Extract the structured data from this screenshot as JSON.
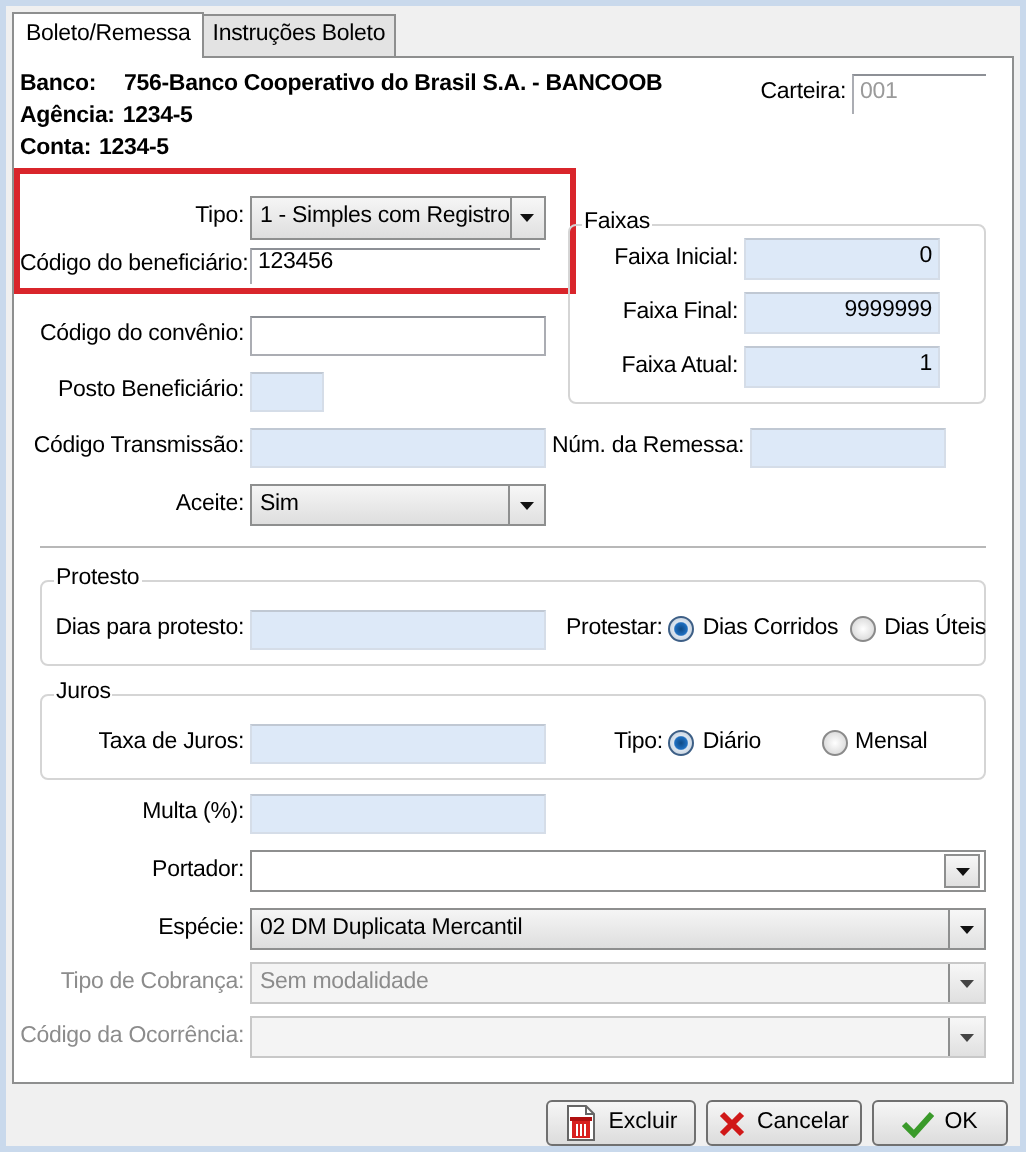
{
  "tabs": [
    {
      "label": "Boleto/Remessa",
      "selected": true
    },
    {
      "label": "Instruções Boleto",
      "selected": false
    }
  ],
  "bank_info": [
    {
      "label": "Banco:",
      "value": "756-Banco Cooperativo do Brasil S.A. - BANCOOB"
    },
    {
      "label": "Agência:",
      "value": "1234-5"
    },
    {
      "label": "Conta:",
      "value": "1234-5"
    }
  ],
  "carteira": {
    "label": "Carteira:",
    "value": "001",
    "disabled": true
  },
  "highlighted_fields": [
    {
      "kind": "dropdown",
      "label": "Tipo:",
      "value": "1 - Simples com Registro"
    },
    {
      "kind": "text",
      "label": "Código do beneficiário:",
      "value": "123456",
      "numeric": false
    }
  ],
  "convenio": {
    "label": "Código do convênio:",
    "numeric": false
  },
  "posto": {
    "label": "Posto Beneficiário:",
    "numeric": true
  },
  "faixas": {
    "title": "Faixas",
    "fields": [
      {
        "label": "Faixa Inicial:",
        "value": "0",
        "numeric": true
      },
      {
        "label": "Faixa Final:",
        "value": "9999999",
        "numeric": true
      },
      {
        "label": "Faixa Atual:",
        "value": "1",
        "numeric": true
      }
    ]
  },
  "transmissao": {
    "label": "Código Transmissão:",
    "numeric": true
  },
  "remessa": {
    "label": "Núm. da Remessa:",
    "numeric": true
  },
  "aceite": {
    "label": "Aceite:",
    "value": "Sim"
  },
  "protesto": {
    "title": "Protesto",
    "field_label": "Dias para protesto:",
    "numeric": true,
    "radio_label": "Protestar:",
    "options": [
      {
        "label": "Dias Corridos",
        "selected": true
      },
      {
        "label": "Dias Úteis",
        "selected": false
      }
    ]
  },
  "juros": {
    "title": "Juros",
    "field_label": "Taxa de Juros:",
    "numeric": true,
    "radio_label": "Tipo:",
    "options": [
      {
        "label": "Diário",
        "selected": true
      },
      {
        "label": "Mensal",
        "selected": false
      }
    ]
  },
  "multa": {
    "label": "Multa (%):",
    "numeric": true
  },
  "dropdowns": [
    {
      "kind": "combo",
      "label": "Portador:",
      "disabled": false
    },
    {
      "kind": "select",
      "label": "Espécie:",
      "value": "02 DM Duplicata Mercantil",
      "disabled": false
    },
    {
      "kind": "select",
      "label": "Tipo de Cobrança:",
      "value": "Sem modalidade",
      "disabled": true
    },
    {
      "kind": "select",
      "label": "Código da Ocorrência:",
      "disabled": true
    }
  ],
  "buttons": [
    {
      "kind": "delete",
      "label": "Excluir"
    },
    {
      "kind": "cancel",
      "label": "Cancelar"
    },
    {
      "kind": "confirm",
      "label": "OK"
    }
  ]
}
